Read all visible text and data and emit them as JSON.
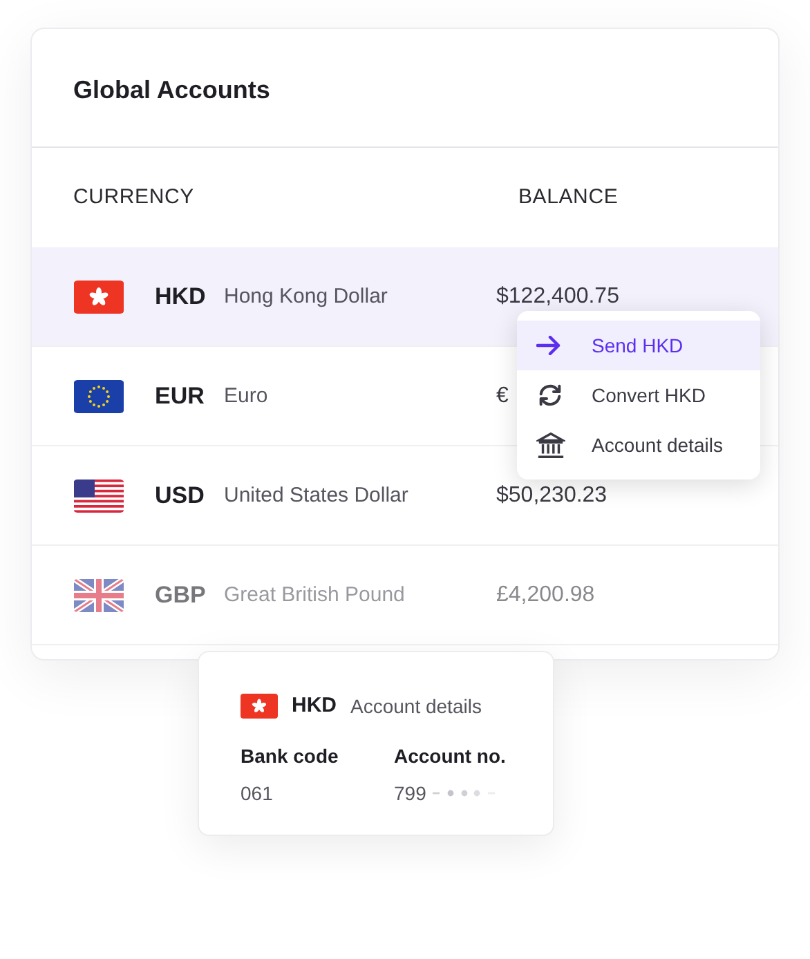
{
  "card": {
    "title": "Global Accounts",
    "columns": [
      "CURRENCY",
      "BALANCE"
    ],
    "rows": [
      {
        "kind": "hk",
        "code": "HKD",
        "name": "Hong Kong Dollar",
        "balance": "$122,400.75",
        "selected": true,
        "dimmed": false
      },
      {
        "kind": "eu",
        "code": "EUR",
        "name": "Euro",
        "balance": "€",
        "selected": false,
        "dimmed": false
      },
      {
        "kind": "us",
        "code": "USD",
        "name": "United States Dollar",
        "balance": "$50,230.23",
        "selected": false,
        "dimmed": false
      },
      {
        "kind": "gb",
        "code": "GBP",
        "name": "Great British Pound",
        "balance": "£4,200.98",
        "selected": false,
        "dimmed": true
      }
    ]
  },
  "menu": [
    {
      "label": "Send HKD",
      "selected": true
    },
    {
      "label": "Convert HKD",
      "selected": false
    },
    {
      "label": "Account details",
      "selected": false
    }
  ],
  "details": {
    "kind": "hk",
    "code": "HKD",
    "title": "Account details",
    "fields": [
      {
        "label": "Bank code",
        "value": "061"
      },
      {
        "label": "Account no.",
        "value": "799"
      }
    ]
  }
}
